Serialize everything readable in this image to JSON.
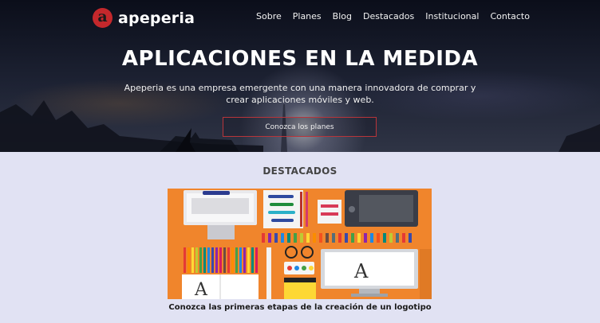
{
  "brand": {
    "logo_letter": "a",
    "name": "apeperia"
  },
  "nav": [
    {
      "label": "Sobre"
    },
    {
      "label": "Planes"
    },
    {
      "label": "Blog"
    },
    {
      "label": "Destacados"
    },
    {
      "label": "Institucional"
    },
    {
      "label": "Contacto"
    }
  ],
  "hero": {
    "title": "APLICACIONES EN LA MEDIDA",
    "subtitle": "Apeperia es una empresa emergente con una manera innovadora de comprar y crear aplicaciones móviles y web.",
    "button_label": "Conozca los planes"
  },
  "featured": {
    "section_title": "DESTACADOS",
    "image_letters": [
      "A",
      "A"
    ],
    "caption": "Conozca las primeras etapas de la creación de un logotipo"
  },
  "colors": {
    "brand_red": "#c4282c",
    "page_bg": "#e1e2f3",
    "image_orange": "#f0852c"
  }
}
